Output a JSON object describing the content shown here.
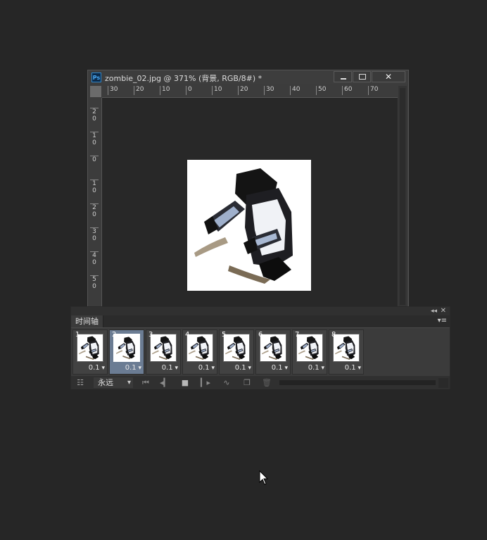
{
  "document": {
    "app_icon_label": "Ps",
    "title": "zombie_02.jpg @ 371% (背景, RGB/8#) *",
    "close_glyph": "✕",
    "ruler_h": [
      "30",
      "20",
      "10",
      "0",
      "10",
      "20",
      "30",
      "40",
      "50",
      "60",
      "70"
    ],
    "ruler_v": [
      [
        "2",
        "0"
      ],
      [
        "1",
        "0"
      ],
      [
        "0"
      ],
      [
        "1",
        "0"
      ],
      [
        "2",
        "0"
      ],
      [
        "3",
        "0"
      ],
      [
        "4",
        "0"
      ],
      [
        "5",
        "0"
      ]
    ]
  },
  "timeline": {
    "tab_label": "时间轴",
    "collapse_glyph": "◂◂",
    "close_glyph": "✕",
    "menu_glyph": "▾≡",
    "selected_frame": 2,
    "frames": [
      {
        "number": "1",
        "delay": "0.1"
      },
      {
        "number": "2",
        "delay": "0.1"
      },
      {
        "number": "3",
        "delay": "0.1"
      },
      {
        "number": "4",
        "delay": "0.1"
      },
      {
        "number": "5",
        "delay": "0.1"
      },
      {
        "number": "6",
        "delay": "0.1"
      },
      {
        "number": "7",
        "delay": "0.1"
      },
      {
        "number": "8",
        "delay": "0.1"
      }
    ],
    "loop_option": "永远",
    "controls": {
      "convert": "☷",
      "first": "⏮",
      "prev": "◂▎",
      "stop": "■",
      "next": "▎▸",
      "tween": "∿",
      "duplicate": "❐",
      "delete": "🗑"
    }
  },
  "colors": {
    "background": "#262626",
    "selected_frame": "#6b7c93",
    "ps_icon": "#2d84c8"
  }
}
